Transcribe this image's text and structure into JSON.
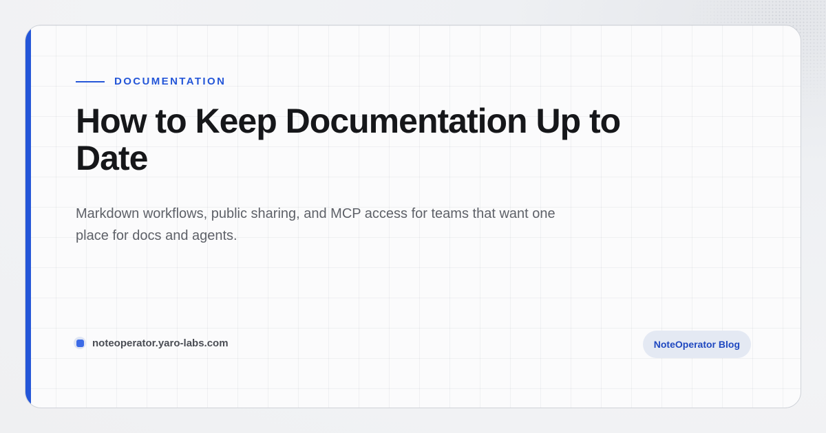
{
  "category": "DOCUMENTATION",
  "title": "How to Keep Documentation Up to Date",
  "subtitle": "Markdown workflows, public sharing, and MCP access for teams that want one place for docs and agents.",
  "site": {
    "domain": "noteoperator.yaro-labs.com",
    "icon": "logo-square-icon"
  },
  "badge": "NoteOperator Blog",
  "colors": {
    "accent": "#2456d8",
    "title": "#16171a",
    "subtitle": "#5e6168",
    "badge_bg": "#e4e9f3",
    "badge_text": "#1f48c0"
  }
}
